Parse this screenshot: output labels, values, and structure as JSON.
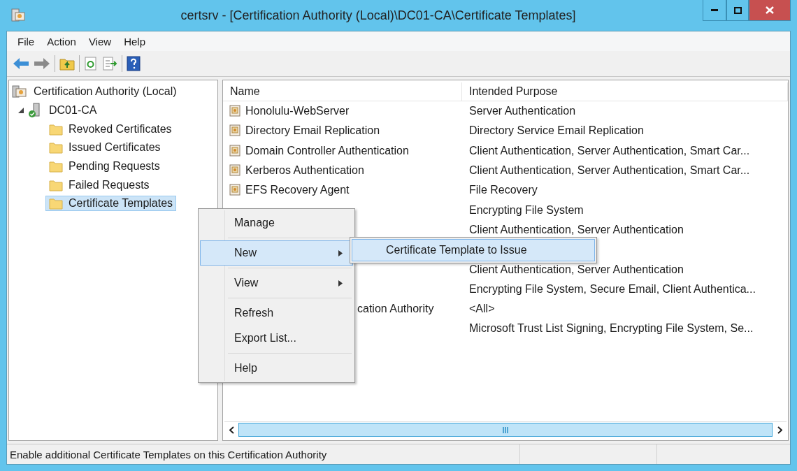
{
  "window": {
    "title": "certsrv - [Certification Authority (Local)\\DC01-CA\\Certificate Templates]"
  },
  "menu_bar": [
    "File",
    "Action",
    "View",
    "Help"
  ],
  "tree": {
    "label": "Certification Authority (Local)",
    "selected": false,
    "children": [
      {
        "label": "DC01-CA",
        "selected": false,
        "expanded": true,
        "children": [
          {
            "label": "Revoked Certificates",
            "selected": false
          },
          {
            "label": "Issued Certificates",
            "selected": false
          },
          {
            "label": "Pending Requests",
            "selected": false
          },
          {
            "label": "Failed Requests",
            "selected": false
          },
          {
            "label": "Certificate Templates",
            "selected": true
          }
        ]
      }
    ]
  },
  "list": {
    "columns": [
      "Name",
      "Intended Purpose"
    ],
    "rows": [
      {
        "name": "Honolulu-WebServer",
        "purpose": "Server Authentication"
      },
      {
        "name": "Directory Email Replication",
        "purpose": "Directory Service Email Replication"
      },
      {
        "name": "Domain Controller Authentication",
        "purpose": "Client Authentication, Server Authentication, Smart Car..."
      },
      {
        "name": "Kerberos Authentication",
        "purpose": "Client Authentication, Server Authentication, Smart Car..."
      },
      {
        "name": "EFS Recovery Agent",
        "purpose": "File Recovery"
      },
      {
        "purpose": "Encrypting File System"
      },
      {
        "purpose": "Client Authentication, Server Authentication"
      },
      {},
      {
        "purpose": "Client Authentication, Server Authentication"
      },
      {
        "purpose": "Encrypting File System, Secure Email, Client Authentica..."
      },
      {
        "name": "cation Authority",
        "name_covered": true,
        "purpose": "<All>"
      },
      {
        "purpose": "Microsoft Trust List Signing, Encrypting File System, Se..."
      }
    ]
  },
  "context_menu": {
    "items": [
      {
        "kind": "item",
        "label": "Manage",
        "selected": false,
        "submenu": false
      },
      {
        "kind": "separator"
      },
      {
        "kind": "item",
        "label": "New",
        "selected": true,
        "submenu": true
      },
      {
        "kind": "separator"
      },
      {
        "kind": "item",
        "label": "View",
        "selected": false,
        "submenu": true
      },
      {
        "kind": "separator"
      },
      {
        "kind": "item",
        "label": "Refresh",
        "selected": false,
        "submenu": false
      },
      {
        "kind": "item",
        "label": "Export List...",
        "selected": false,
        "submenu": false
      },
      {
        "kind": "separator"
      },
      {
        "kind": "item",
        "label": "Help",
        "selected": false,
        "submenu": false
      }
    ]
  },
  "submenu": {
    "items": [
      {
        "label": "Certificate Template to Issue",
        "selected": true
      }
    ]
  },
  "status_bar": {
    "text": "Enable additional Certificate Templates on this Certification Authority"
  }
}
